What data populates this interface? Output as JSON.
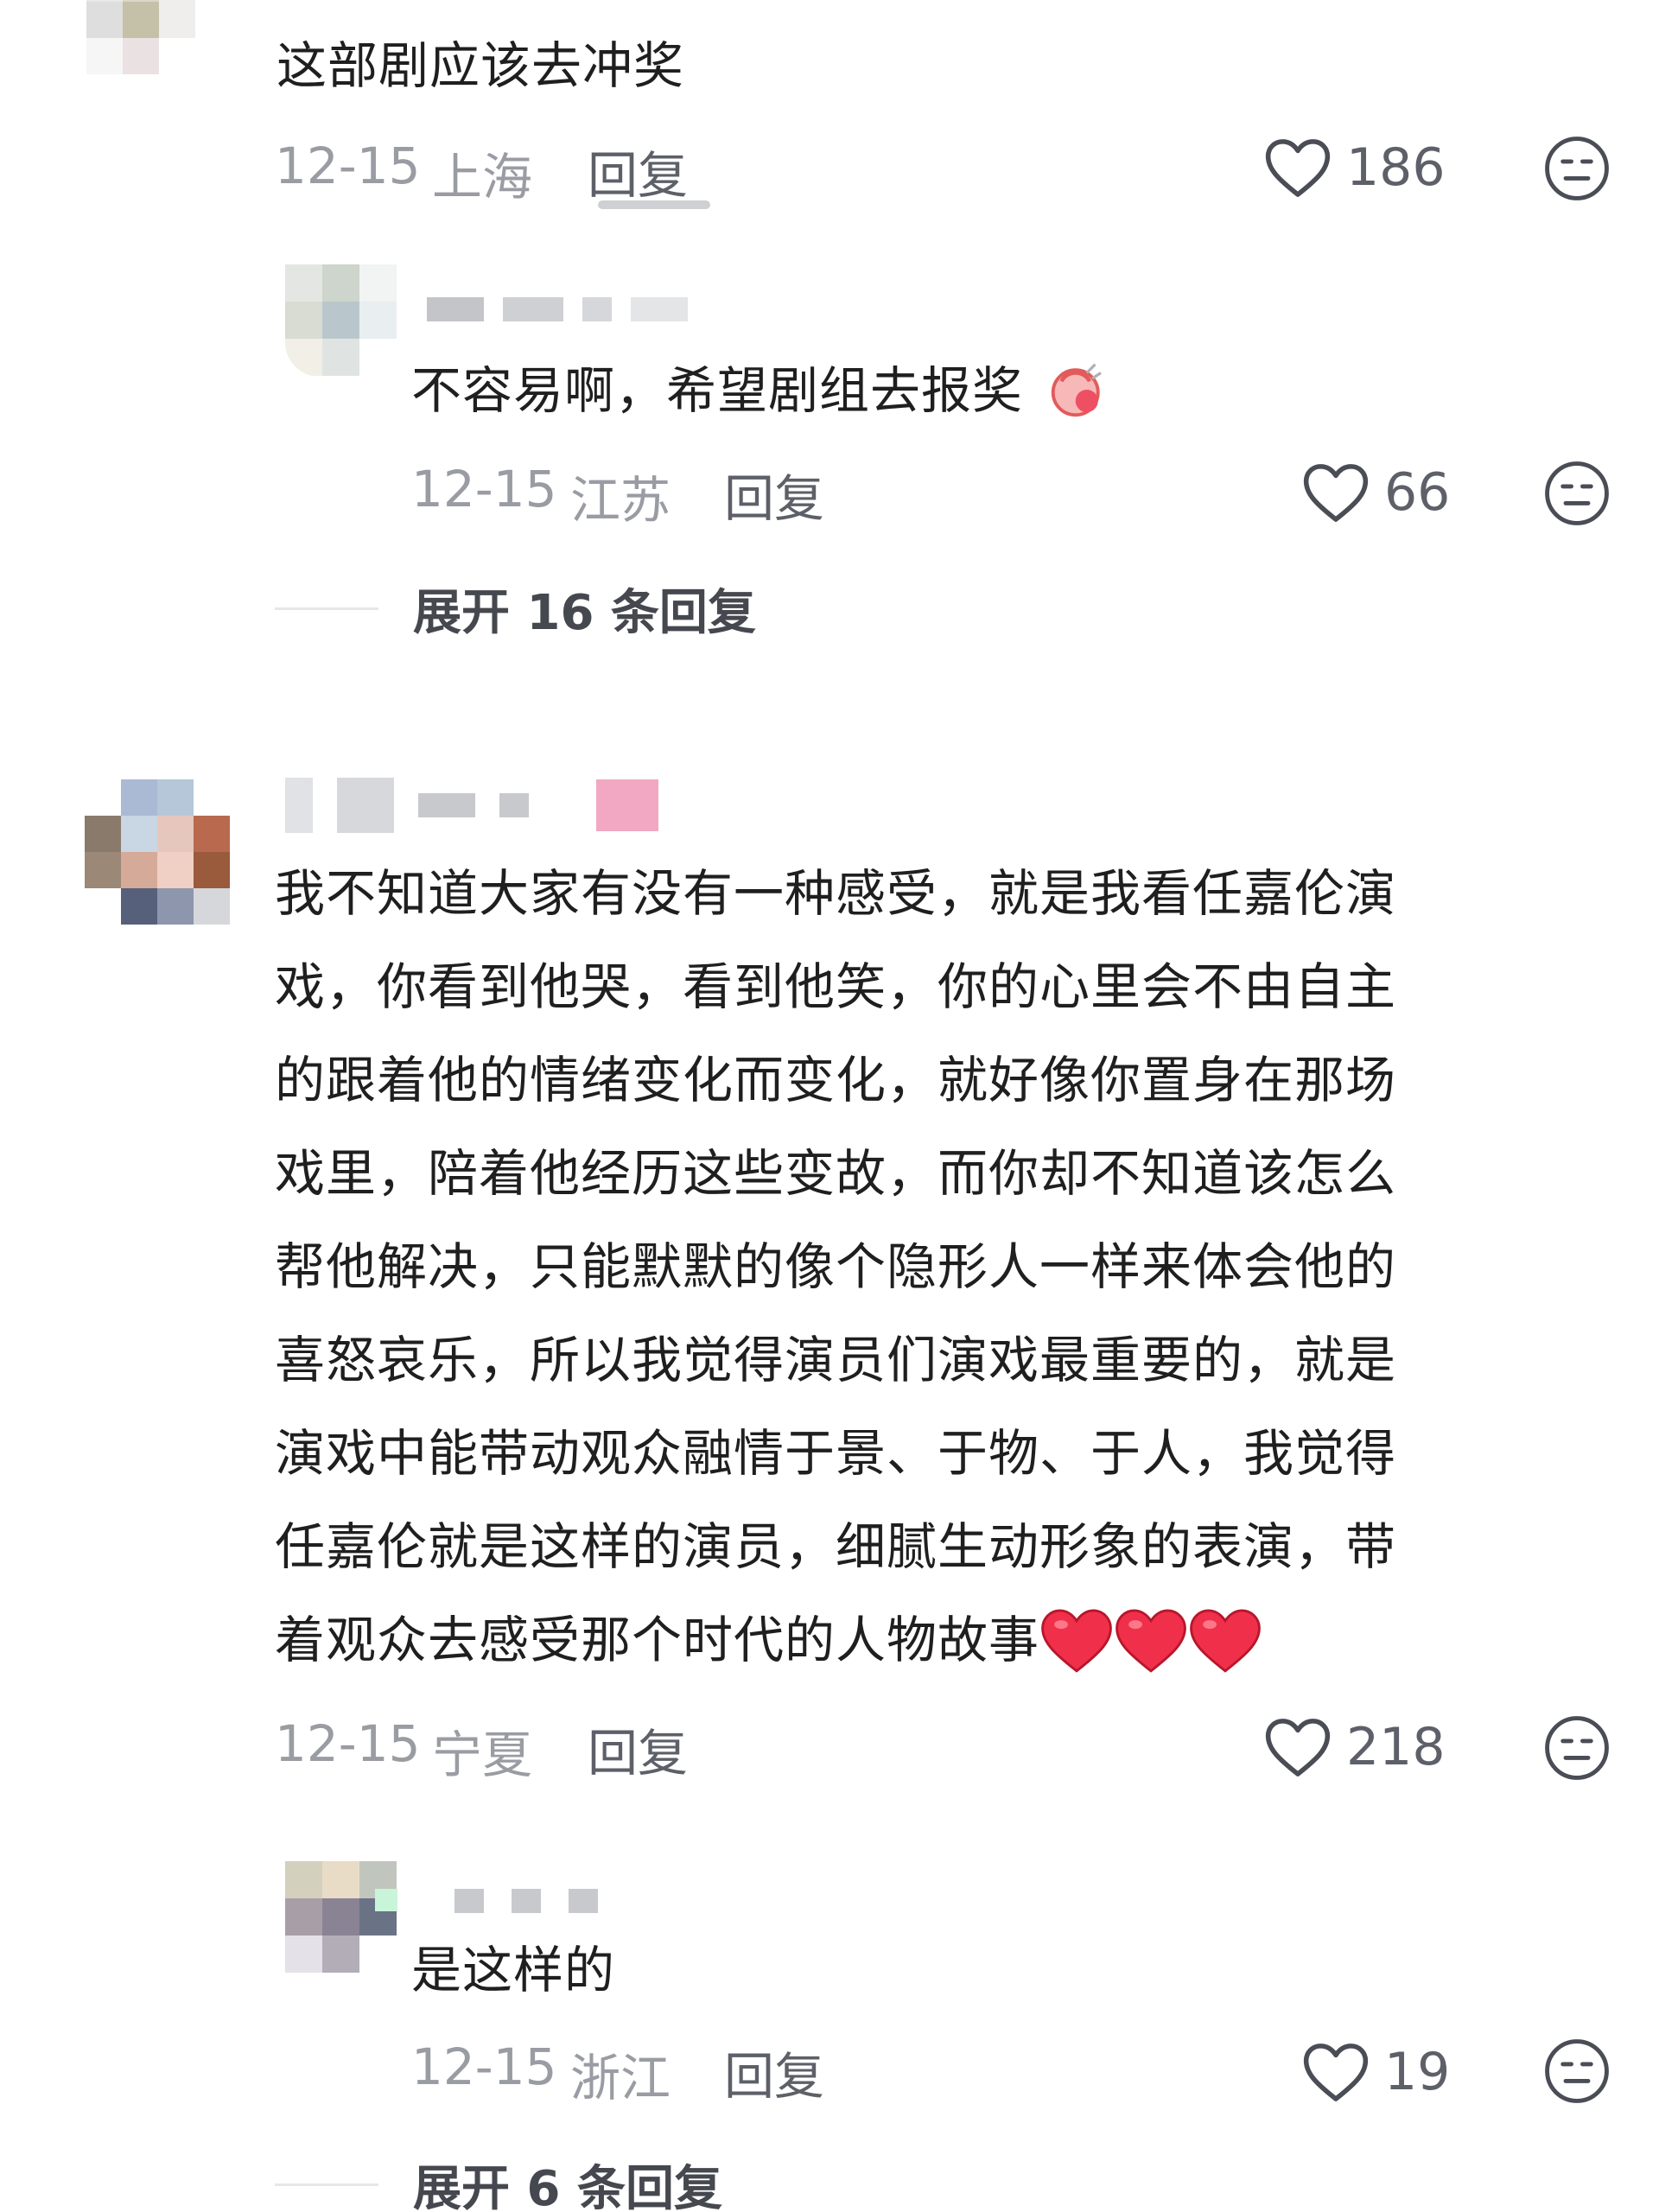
{
  "comments": [
    {
      "text": "这部剧应该去冲奖",
      "date": "12-15",
      "location": "上海",
      "reply_label": "回复",
      "likes": "186",
      "replies": [
        {
          "text": "不容易啊，希望剧组去报奖",
          "date": "12-15",
          "location": "江苏",
          "reply_label": "回复",
          "likes": "66"
        }
      ],
      "expand_label": "展开 16 条回复"
    },
    {
      "text_lines": [
        "我不知道大家有没有一种感受，就是我看任嘉伦演",
        "戏，你看到他哭，看到他笑，你的心里会不由自主",
        "的跟着他的情绪变化而变化，就好像你置身在那场",
        "戏里，陪着他经历这些变故，而你却不知道该怎么",
        "帮他解决，只能默默的像个隐形人一样来体会他的",
        "喜怒哀乐，所以我觉得演员们演戏最重要的，就是",
        "演戏中能带动观众融情于景、于物、于人，我觉得",
        "任嘉伦就是这样的演员，细腻生动形象的表演，带",
        "着观众去感受那个时代的人物故事"
      ],
      "date": "12-15",
      "location": "宁夏",
      "reply_label": "回复",
      "likes": "218",
      "replies": [
        {
          "text": "是这样的",
          "date": "12-15",
          "location": "浙江",
          "reply_label": "回复",
          "likes": "19"
        }
      ],
      "expand_label": "展开 6 条回复"
    }
  ],
  "icons": {
    "like": "heart-outline-icon",
    "dislike": "neutral-face-icon",
    "reply_emoji": "hands-emoji",
    "inline_hearts": "red-heart-emoji"
  },
  "colors": {
    "primary_text": "#1f1f1f",
    "meta_text": "#9a9ca3",
    "action_text": "#5d6068",
    "heart_red": "#f02b46"
  }
}
